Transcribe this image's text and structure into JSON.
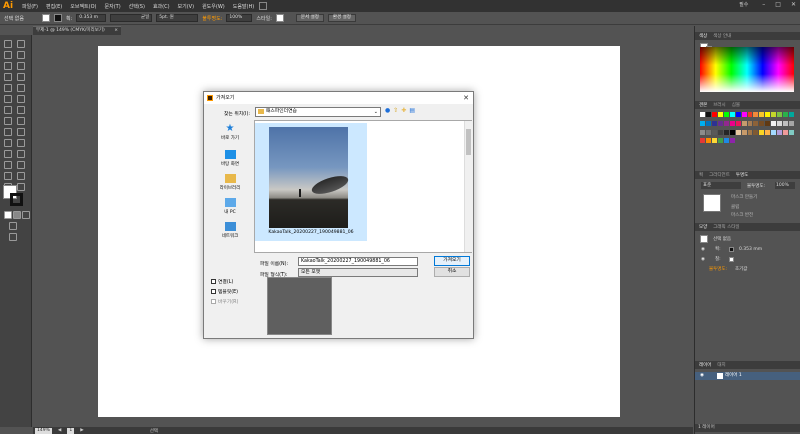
{
  "app": {
    "logo": "Ai",
    "menu": [
      "파일(F)",
      "편집(E)",
      "오브젝트(O)",
      "문자(T)",
      "선택(S)",
      "효과(C)",
      "보기(V)",
      "윈도우(W)",
      "도움말(H)"
    ],
    "workspace": "필수",
    "window_controls": [
      "–",
      "□",
      "✕"
    ]
  },
  "control_bar": {
    "selection_label": "선택 없음",
    "stroke_label": "획:",
    "stroke_value": "0.353 m",
    "uniform": "균일",
    "brush": "5pt. 원",
    "opacity_label": "불투명도:",
    "opacity_value": "100%",
    "style_label": "스타일:",
    "doc_setup": "문서 설정",
    "prefs": "환경 설정"
  },
  "document_tab": {
    "title": "무제-1 @ 149% (CMYK/미리보기)",
    "close": "×"
  },
  "status_bar": {
    "zoom": "149%",
    "page": "1",
    "selection": "선택"
  },
  "panels": {
    "color_tabs": [
      "색상",
      "색상 안내"
    ],
    "swatch_tabs": [
      "견본",
      "브러시",
      "심볼"
    ],
    "transparency_tabs": [
      "획",
      "그라디언트",
      "투명도"
    ],
    "blend_mode": "표준",
    "opacity_label": "불투명도:",
    "opacity_value": "100%",
    "make_mask": "마스크 만들기",
    "clip": "클립",
    "invert_mask": "마스크 반전",
    "appearance_tabs": [
      "모양",
      "그래픽 스타일"
    ],
    "no_selection": "선택 없음",
    "stroke_row": "획:",
    "stroke_row_value": "0.353 mm",
    "fill_row": "칠:",
    "opacity_row": "불투명도:",
    "opacity_row_value": "초기값",
    "layers_tabs": [
      "레이어",
      "대지"
    ],
    "layer_name": "레이어 1",
    "layer_count": "1 레이어"
  },
  "dialog": {
    "title": "가져오기",
    "close": "✕",
    "look_in_label": "찾는 위치(I):",
    "look_in_value": "패스파인더연습",
    "places": [
      "바로 가기",
      "바탕 화면",
      "라이브러리",
      "내 PC",
      "네트워크"
    ],
    "file_caption": "KakaoTalk_20200227_190049881_06",
    "filename_label": "파일 이름(N):",
    "filename_value": "KakaoTalk_20200227_190049881_06",
    "filetype_label": "파일 형식(T):",
    "filetype_value": "모든 포맷",
    "open_button": "가져오기",
    "cancel_button": "취소",
    "check_link": "연결(L)",
    "check_template": "템플릿(E)",
    "check_replace": "바꾸기(R)"
  }
}
